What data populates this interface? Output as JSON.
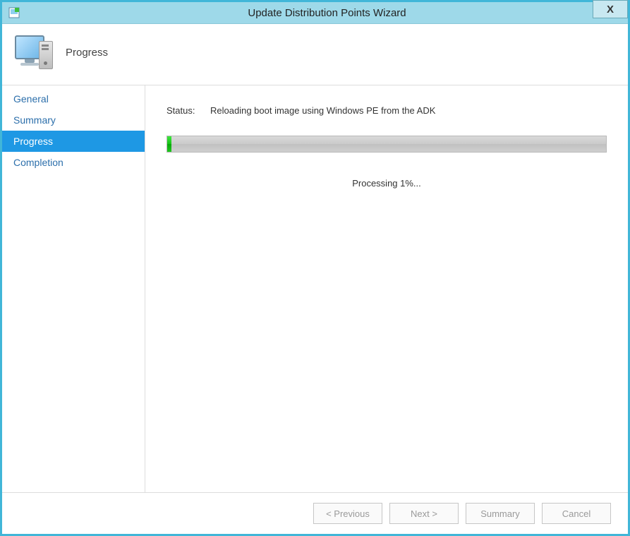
{
  "window": {
    "title": "Update Distribution Points Wizard"
  },
  "header": {
    "page_title": "Progress"
  },
  "sidebar": {
    "items": [
      {
        "label": "General",
        "active": false
      },
      {
        "label": "Summary",
        "active": false
      },
      {
        "label": "Progress",
        "active": true
      },
      {
        "label": "Completion",
        "active": false
      }
    ]
  },
  "content": {
    "status_label": "Status:",
    "status_text": "Reloading boot image using Windows PE from the ADK",
    "progress_percent": 1,
    "processing_text": "Processing 1%..."
  },
  "footer": {
    "previous": "< Previous",
    "next": "Next >",
    "summary": "Summary",
    "cancel": "Cancel"
  }
}
